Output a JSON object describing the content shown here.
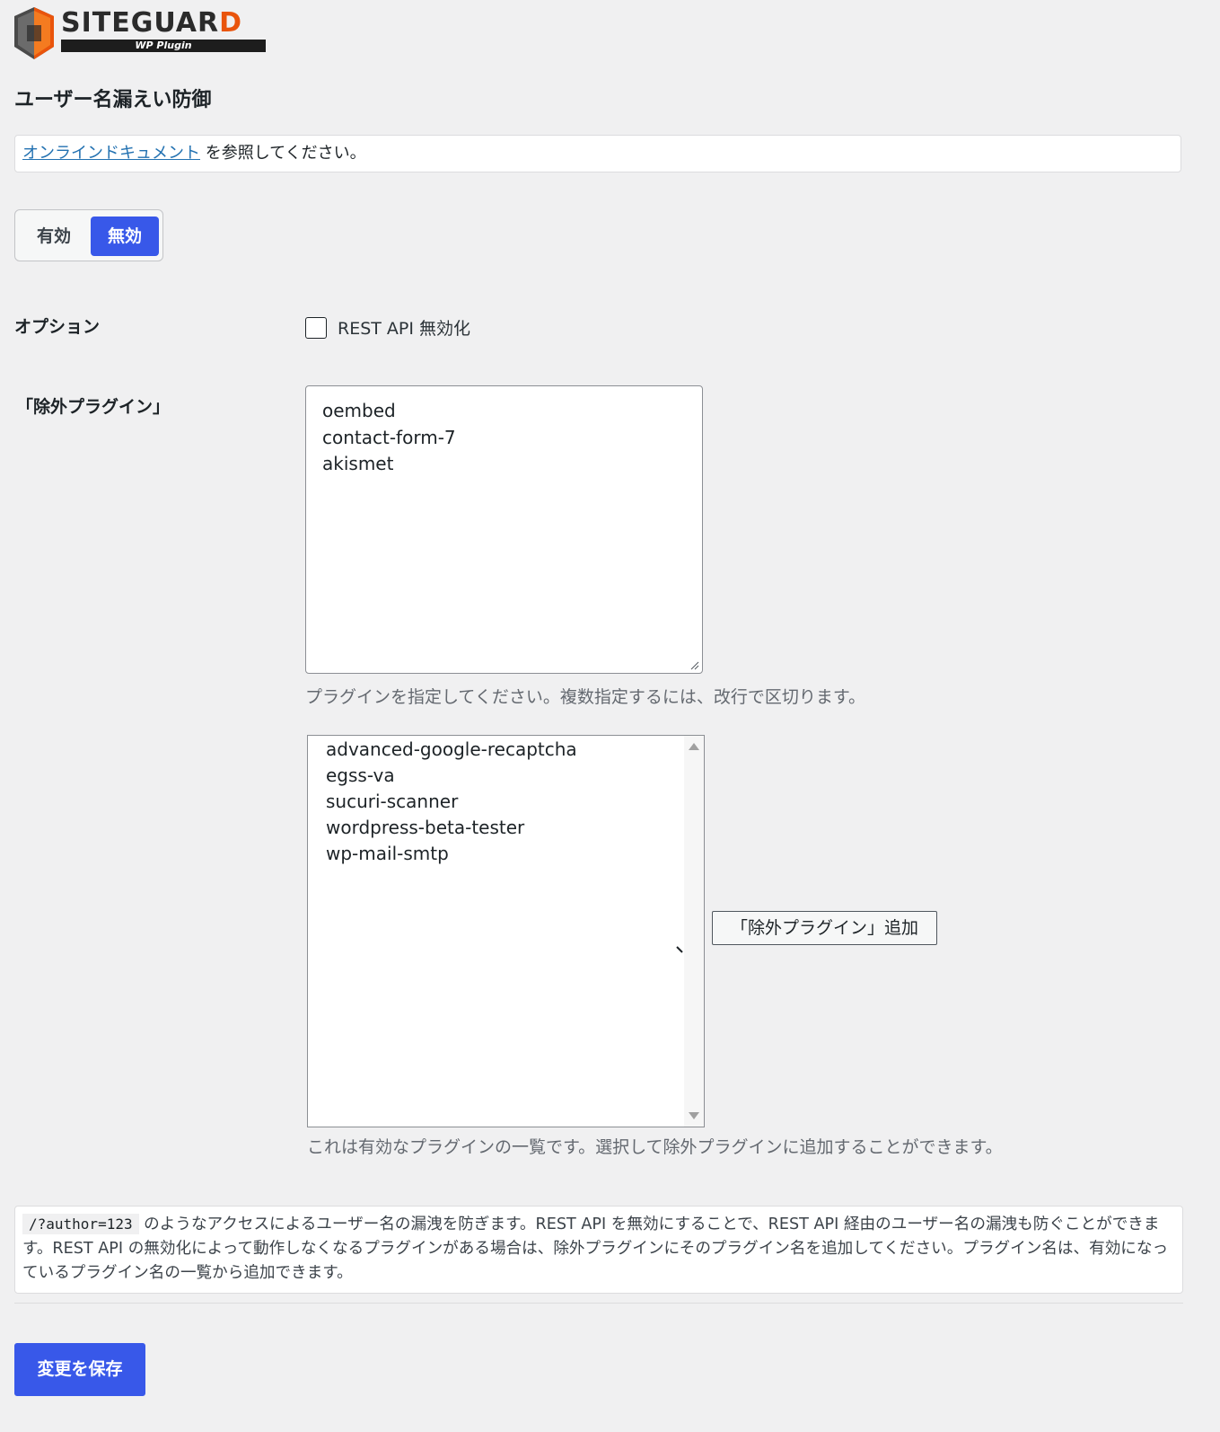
{
  "logo": {
    "brand_main": "SITEGUAR",
    "brand_accent": "D",
    "sub": "WP Plugin"
  },
  "page": {
    "title": "ユーザー名漏えい防御"
  },
  "notice": {
    "link_text": "オンラインドキュメント",
    "rest_text": " を参照してください。"
  },
  "toggle": {
    "on_label": "有効",
    "off_label": "無効",
    "selected": "無効"
  },
  "options": {
    "label": "オプション",
    "checkbox_label": "REST API 無効化",
    "checked": false
  },
  "exclude": {
    "label": "「除外プラグイン」",
    "textarea_lines": [
      "oembed",
      "contact-form-7",
      "akismet"
    ],
    "textarea_help": "プラグインを指定してください。複数指定するには、改行で区切ります。",
    "active_plugins": [
      "advanced-google-recaptcha",
      "egss-va",
      "sucuri-scanner",
      "wordpress-beta-tester",
      "wp-mail-smtp"
    ],
    "list_help": "これは有効なプラグインの一覧です。選択して除外プラグインに追加することができます。",
    "add_button": "「除外プラグイン」追加"
  },
  "info": {
    "code": "/?author=123",
    "text": " のようなアクセスによるユーザー名の漏洩を防ぎます。REST API を無効にすることで、REST API 経由のユーザー名の漏洩も防ぐことができます。REST API の無効化によって動作しなくなるプラグインがある場合は、除外プラグインにそのプラグイン名を追加してください。プラグイン名は、有効になっているプラグイン名の一覧から追加できます。"
  },
  "save_button": "変更を保存",
  "colors": {
    "accent": "#3858e9",
    "link": "#2271b1",
    "background": "#f0f0f1",
    "logo_orange": "#e9540c"
  },
  "icons": {
    "logo": "siteguard-shield-icon",
    "resize": "resize-grip-icon",
    "scroll_up": "triangle-up-icon",
    "scroll_down": "triangle-down-icon"
  }
}
